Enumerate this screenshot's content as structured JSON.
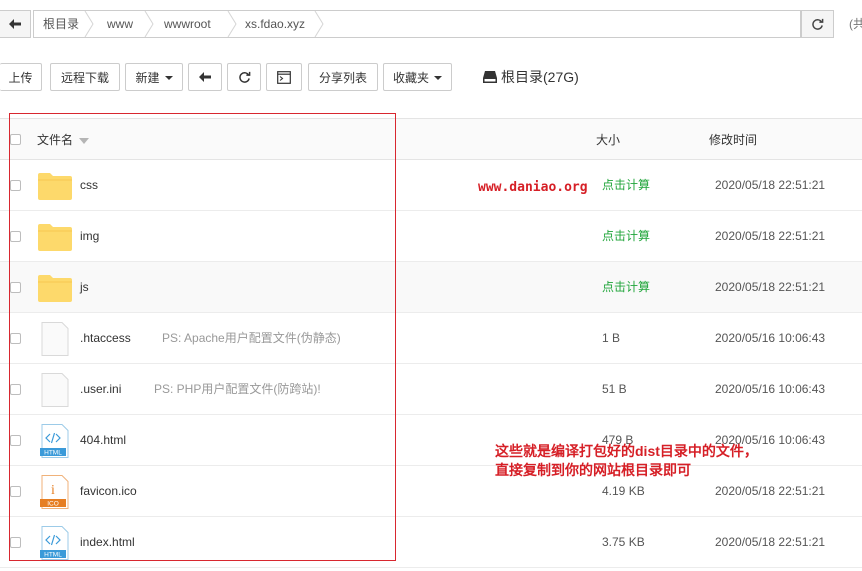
{
  "address_bar": {
    "crumbs": [
      "根目录",
      "www",
      "wwwroot",
      "xs.fdao.xyz"
    ],
    "extra_text": "(共"
  },
  "toolbar": {
    "upload_label": "上传",
    "remote_download_label": "远程下载",
    "new_label": "新建",
    "share_list_label": "分享列表",
    "favorites_label": "收藏夹",
    "root_label": "根目录(27G)"
  },
  "table": {
    "columns": {
      "name": "文件名",
      "size": "大小",
      "modified": "修改时间"
    },
    "rows": [
      {
        "name": "css",
        "icon": "folder-icon",
        "note": "",
        "size": "点击计算",
        "modified": "2020/05/18 22:51:21"
      },
      {
        "name": "img",
        "icon": "folder-icon",
        "note": "",
        "size": "点击计算",
        "modified": "2020/05/18 22:51:21"
      },
      {
        "name": "js",
        "icon": "folder-icon",
        "note": "",
        "size": "点击计算",
        "modified": "2020/05/18 22:51:21"
      },
      {
        "name": ".htaccess",
        "icon": "file-icon",
        "note": "PS: Apache用户配置文件(伪静态)",
        "size": "1 B",
        "modified": "2020/05/16 10:06:43"
      },
      {
        "name": ".user.ini",
        "icon": "file-icon",
        "note": "PS: PHP用户配置文件(防跨站)!",
        "size": "51 B",
        "modified": "2020/05/16 10:06:43"
      },
      {
        "name": "404.html",
        "icon": "html-file-icon",
        "note": "",
        "size": "479 B",
        "modified": "2020/05/16 10:06:43"
      },
      {
        "name": "favicon.ico",
        "icon": "ico-file-icon",
        "note": "",
        "size": "4.19 KB",
        "modified": "2020/05/18 22:51:21"
      },
      {
        "name": "index.html",
        "icon": "html-file-icon",
        "note": "",
        "size": "3.75 KB",
        "modified": "2020/05/18 22:51:21"
      }
    ],
    "icon_badges": {
      "html": "HTML",
      "ico": "ICO",
      "ico_letter": "i"
    }
  },
  "annotations": {
    "watermark": "www.daniao.org",
    "note_line1": "这些就是编译打包好的dist目录中的文件，",
    "note_line2": "直接复制到你的网站根目录即可"
  },
  "colors": {
    "folder": "#fdd96b",
    "calc_green": "#20a53a",
    "annotation_red": "#d61f26",
    "html_blue": "#3a9ad9",
    "ico_orange": "#e67e22"
  }
}
